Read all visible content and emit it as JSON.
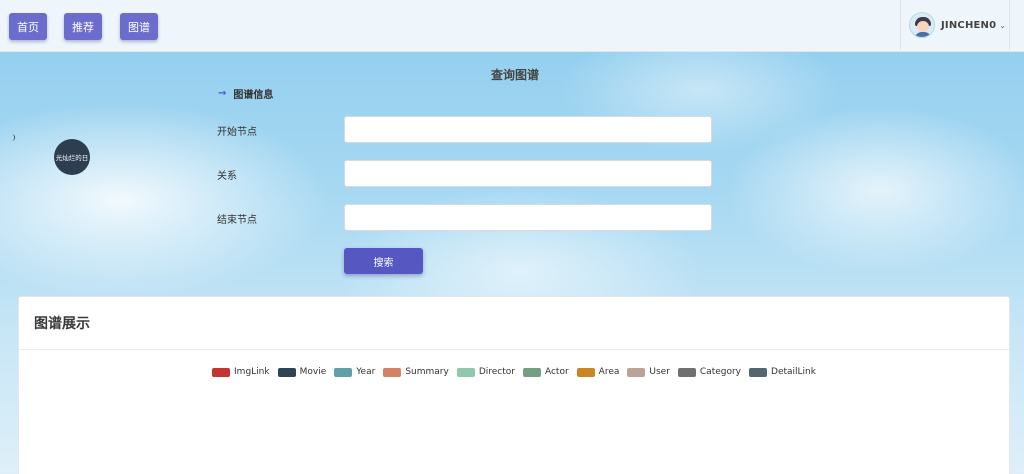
{
  "nav": {
    "home_label": "首页",
    "recommend_label": "推荐",
    "graph_label": "图谱"
  },
  "user": {
    "name": "JINCHEN0",
    "avatar_icon": "user-avatar-icon",
    "dropdown_icon": "chevron-down-icon"
  },
  "query": {
    "title": "查询图谱",
    "section_label": "图谱信息",
    "section_icon": "arrow-right-icon",
    "fields": [
      {
        "label": "开始节点",
        "value": "",
        "placeholder": ""
      },
      {
        "label": "关系",
        "value": "",
        "placeholder": ""
      },
      {
        "label": "结束节点",
        "value": "",
        "placeholder": ""
      }
    ],
    "search_label": "搜索"
  },
  "graph_card": {
    "title": "图谱展示",
    "legend": [
      {
        "name": "ImgLink",
        "color": "#c23531"
      },
      {
        "name": "Movie",
        "color": "#2f4554"
      },
      {
        "name": "Year",
        "color": "#61a0a8"
      },
      {
        "name": "Summary",
        "color": "#d48265"
      },
      {
        "name": "Director",
        "color": "#91c7ae"
      },
      {
        "name": "Actor",
        "color": "#749f83"
      },
      {
        "name": "Area",
        "color": "#ca8622"
      },
      {
        "name": "User",
        "color": "#bda29a"
      },
      {
        "name": "Category",
        "color": "#6e7074"
      },
      {
        "name": "DetailLink",
        "color": "#546570"
      }
    ],
    "node_label": "光灿烂的日"
  },
  "colors": {
    "nav_button": "#6c6ccc",
    "search_button": "#5757c2",
    "accent_arrow": "#4e5bd6"
  }
}
